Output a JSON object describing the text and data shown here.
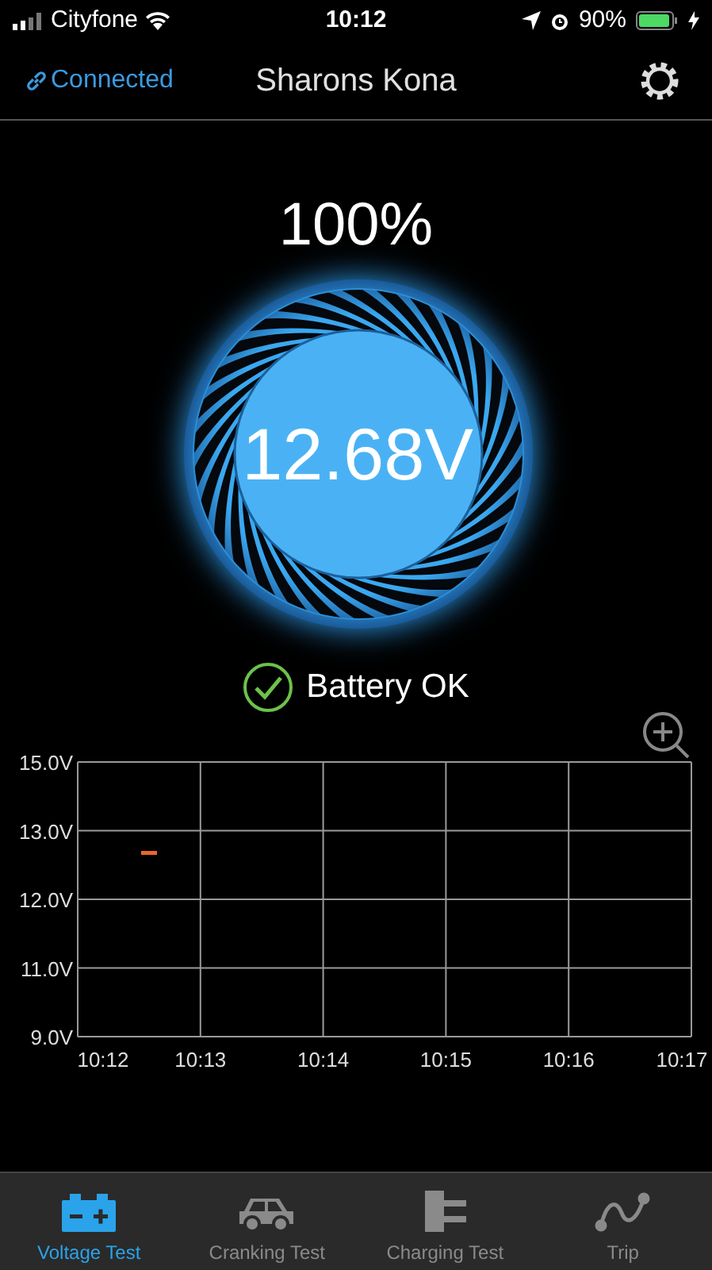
{
  "status_bar": {
    "carrier": "Cityfone",
    "time": "10:12",
    "battery": "90%"
  },
  "nav": {
    "connection": "Connected",
    "title": "Sharons Kona"
  },
  "gauge": {
    "percent": "100%",
    "voltage": "12.68V"
  },
  "status": {
    "text": "Battery OK",
    "ok": true
  },
  "chart": {
    "y_labels": [
      "15.0V",
      "13.0V",
      "12.0V",
      "11.0V",
      "9.0V"
    ],
    "x_labels": [
      "10:12",
      "10:13",
      "10:14",
      "10:15",
      "10:16",
      "10:17"
    ]
  },
  "tabs": [
    {
      "label": "Voltage Test",
      "kind": "battery",
      "selected": true
    },
    {
      "label": "Cranking Test",
      "kind": "car",
      "selected": false
    },
    {
      "label": "Charging Test",
      "kind": "plug",
      "selected": false
    },
    {
      "label": "Trip",
      "kind": "route",
      "selected": false
    }
  ]
}
